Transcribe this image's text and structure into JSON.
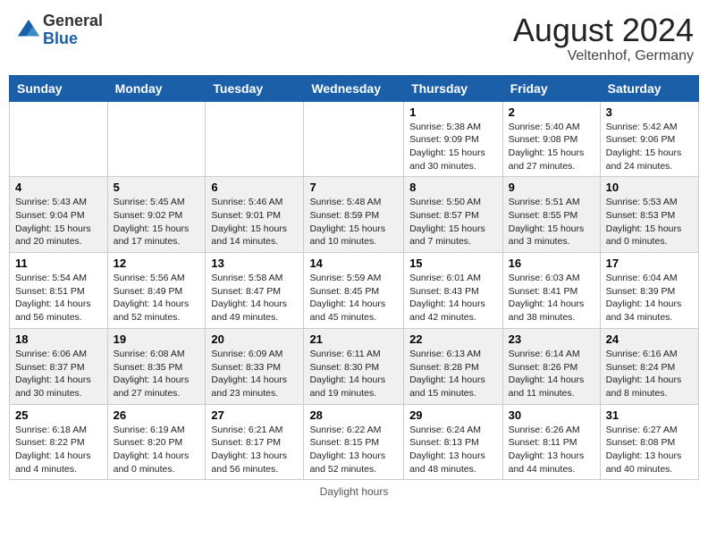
{
  "header": {
    "logo_general": "General",
    "logo_blue": "Blue",
    "month_year": "August 2024",
    "location": "Veltenhof, Germany"
  },
  "days_of_week": [
    "Sunday",
    "Monday",
    "Tuesday",
    "Wednesday",
    "Thursday",
    "Friday",
    "Saturday"
  ],
  "weeks": [
    [
      {
        "day": "",
        "info": ""
      },
      {
        "day": "",
        "info": ""
      },
      {
        "day": "",
        "info": ""
      },
      {
        "day": "",
        "info": ""
      },
      {
        "day": "1",
        "info": "Sunrise: 5:38 AM\nSunset: 9:09 PM\nDaylight: 15 hours\nand 30 minutes."
      },
      {
        "day": "2",
        "info": "Sunrise: 5:40 AM\nSunset: 9:08 PM\nDaylight: 15 hours\nand 27 minutes."
      },
      {
        "day": "3",
        "info": "Sunrise: 5:42 AM\nSunset: 9:06 PM\nDaylight: 15 hours\nand 24 minutes."
      }
    ],
    [
      {
        "day": "4",
        "info": "Sunrise: 5:43 AM\nSunset: 9:04 PM\nDaylight: 15 hours\nand 20 minutes."
      },
      {
        "day": "5",
        "info": "Sunrise: 5:45 AM\nSunset: 9:02 PM\nDaylight: 15 hours\nand 17 minutes."
      },
      {
        "day": "6",
        "info": "Sunrise: 5:46 AM\nSunset: 9:01 PM\nDaylight: 15 hours\nand 14 minutes."
      },
      {
        "day": "7",
        "info": "Sunrise: 5:48 AM\nSunset: 8:59 PM\nDaylight: 15 hours\nand 10 minutes."
      },
      {
        "day": "8",
        "info": "Sunrise: 5:50 AM\nSunset: 8:57 PM\nDaylight: 15 hours\nand 7 minutes."
      },
      {
        "day": "9",
        "info": "Sunrise: 5:51 AM\nSunset: 8:55 PM\nDaylight: 15 hours\nand 3 minutes."
      },
      {
        "day": "10",
        "info": "Sunrise: 5:53 AM\nSunset: 8:53 PM\nDaylight: 15 hours\nand 0 minutes."
      }
    ],
    [
      {
        "day": "11",
        "info": "Sunrise: 5:54 AM\nSunset: 8:51 PM\nDaylight: 14 hours\nand 56 minutes."
      },
      {
        "day": "12",
        "info": "Sunrise: 5:56 AM\nSunset: 8:49 PM\nDaylight: 14 hours\nand 52 minutes."
      },
      {
        "day": "13",
        "info": "Sunrise: 5:58 AM\nSunset: 8:47 PM\nDaylight: 14 hours\nand 49 minutes."
      },
      {
        "day": "14",
        "info": "Sunrise: 5:59 AM\nSunset: 8:45 PM\nDaylight: 14 hours\nand 45 minutes."
      },
      {
        "day": "15",
        "info": "Sunrise: 6:01 AM\nSunset: 8:43 PM\nDaylight: 14 hours\nand 42 minutes."
      },
      {
        "day": "16",
        "info": "Sunrise: 6:03 AM\nSunset: 8:41 PM\nDaylight: 14 hours\nand 38 minutes."
      },
      {
        "day": "17",
        "info": "Sunrise: 6:04 AM\nSunset: 8:39 PM\nDaylight: 14 hours\nand 34 minutes."
      }
    ],
    [
      {
        "day": "18",
        "info": "Sunrise: 6:06 AM\nSunset: 8:37 PM\nDaylight: 14 hours\nand 30 minutes."
      },
      {
        "day": "19",
        "info": "Sunrise: 6:08 AM\nSunset: 8:35 PM\nDaylight: 14 hours\nand 27 minutes."
      },
      {
        "day": "20",
        "info": "Sunrise: 6:09 AM\nSunset: 8:33 PM\nDaylight: 14 hours\nand 23 minutes."
      },
      {
        "day": "21",
        "info": "Sunrise: 6:11 AM\nSunset: 8:30 PM\nDaylight: 14 hours\nand 19 minutes."
      },
      {
        "day": "22",
        "info": "Sunrise: 6:13 AM\nSunset: 8:28 PM\nDaylight: 14 hours\nand 15 minutes."
      },
      {
        "day": "23",
        "info": "Sunrise: 6:14 AM\nSunset: 8:26 PM\nDaylight: 14 hours\nand 11 minutes."
      },
      {
        "day": "24",
        "info": "Sunrise: 6:16 AM\nSunset: 8:24 PM\nDaylight: 14 hours\nand 8 minutes."
      }
    ],
    [
      {
        "day": "25",
        "info": "Sunrise: 6:18 AM\nSunset: 8:22 PM\nDaylight: 14 hours\nand 4 minutes."
      },
      {
        "day": "26",
        "info": "Sunrise: 6:19 AM\nSunset: 8:20 PM\nDaylight: 14 hours\nand 0 minutes."
      },
      {
        "day": "27",
        "info": "Sunrise: 6:21 AM\nSunset: 8:17 PM\nDaylight: 13 hours\nand 56 minutes."
      },
      {
        "day": "28",
        "info": "Sunrise: 6:22 AM\nSunset: 8:15 PM\nDaylight: 13 hours\nand 52 minutes."
      },
      {
        "day": "29",
        "info": "Sunrise: 6:24 AM\nSunset: 8:13 PM\nDaylight: 13 hours\nand 48 minutes."
      },
      {
        "day": "30",
        "info": "Sunrise: 6:26 AM\nSunset: 8:11 PM\nDaylight: 13 hours\nand 44 minutes."
      },
      {
        "day": "31",
        "info": "Sunrise: 6:27 AM\nSunset: 8:08 PM\nDaylight: 13 hours\nand 40 minutes."
      }
    ]
  ],
  "footer": {
    "text": "Daylight hours"
  }
}
